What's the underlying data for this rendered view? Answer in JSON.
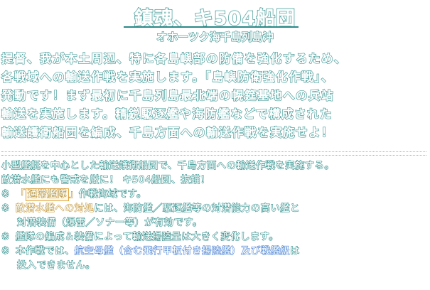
{
  "header": {
    "title": "鎮魂、キ504船団",
    "subtitle": "オホーツク海千島列島沖"
  },
  "briefing": {
    "lines": [
      "提督、我が本土周辺、特に各島嶼部の防備を強化するため、",
      "各戦域への輸送作戦を実施します。「島嶼防衛強化作戦」、",
      "発動です！まず最初に千島列島最北端の幌筵基地への兵站",
      "輸送を実施します。精鋭駆逐艦や海防艦などで構成された",
      "輸送護衛船団を編成、千島方面への輸送作戦を実施せよ！"
    ]
  },
  "details": {
    "intro_lines": [
      "小型艦艇を中心とした輸送護衛船団で、千島方面への輸送作戦を実施する。",
      "敵潜水艦にも警戒を厳に！ キ504船団、抜錨！"
    ],
    "notes": {
      "mark": "※",
      "note1": {
        "bracket_open": "「",
        "tag": "通常艦隊",
        "bracket_close": "」",
        "text": "作戦海域です。"
      },
      "note2": {
        "highlight": "敵潜水艦への対処",
        "text": "には、海防艦／駆逐艦等の対潜能力の高い艦と",
        "line2": "対潜装備（爆雷／ソナー等）が有効です。"
      },
      "note3": {
        "prefix": "艦隊の編成＆装備によって",
        "highlight": "輸送揚陸量は大きく変化",
        "suffix": "します。"
      },
      "note4": {
        "prefix": "本作戦では、",
        "highlight": "航空母艦（含む飛行甲板付き揚陸艦）及び戦艦級",
        "suffix": "は",
        "line2": "投入できません。"
      }
    }
  },
  "colors": {
    "outline_teal": "#2a8a87",
    "accent_orange": "#d88a12",
    "accent_blue": "#3c6fd8",
    "background": "#ffffff"
  }
}
